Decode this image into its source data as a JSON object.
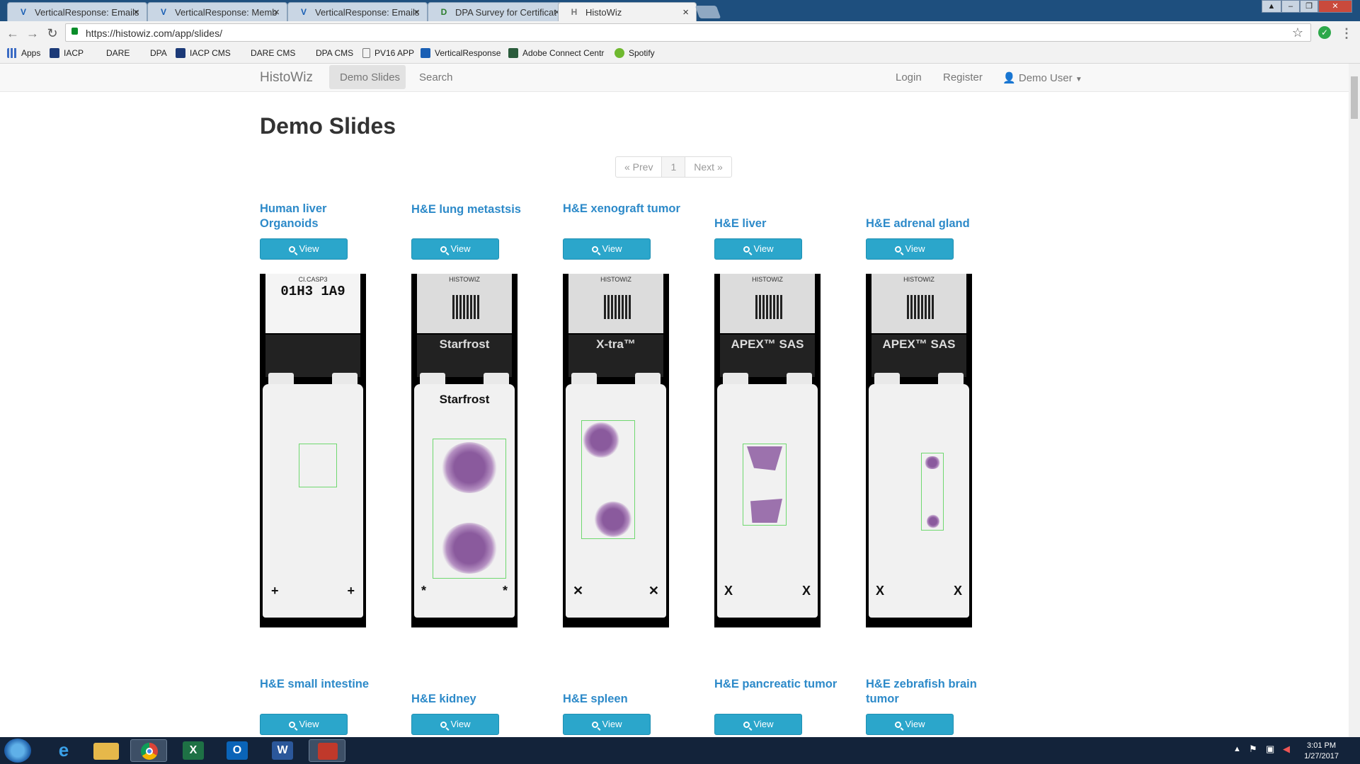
{
  "tabs": [
    {
      "label": "VerticalResponse: Emails",
      "icon": "V"
    },
    {
      "label": "VerticalResponse: Memb",
      "icon": "V"
    },
    {
      "label": "VerticalResponse: Emails",
      "icon": "V"
    },
    {
      "label": "DPA Survey for Certificat",
      "icon": "D"
    },
    {
      "label": "HistoWiz",
      "icon": "H"
    }
  ],
  "address": {
    "url": "https://histowiz.com/app/slides/"
  },
  "bookmarks": [
    "Apps",
    "IACP",
    "DARE",
    "DPA",
    "IACP CMS",
    "DARE CMS",
    "DPA CMS",
    "PV16 APP",
    "VerticalResponse",
    "Adobe Connect Centr",
    "Spotify"
  ],
  "navbar": {
    "brand": "HistoWiz",
    "demo": "Demo Slides",
    "search": "Search",
    "login": "Login",
    "register": "Register",
    "user": "Demo User"
  },
  "page": {
    "title": "Demo Slides",
    "pager": {
      "prev": "« Prev",
      "current": "1",
      "next": "Next »"
    },
    "view_label": "View"
  },
  "slides": [
    {
      "title": "Human liver Organoids",
      "label_top": "CI.CASP3",
      "label_big": "01H3  1A9",
      "mark": "+"
    },
    {
      "title": "H&E lung metastsis",
      "label_top": "HISTOWIZ",
      "label_big": "Starfrost",
      "mark": "*"
    },
    {
      "title": "H&E xenograft tumor",
      "label_top": "HISTOWIZ",
      "label_big": "X-tra™",
      "mark": "✕"
    },
    {
      "title": "H&E liver",
      "label_top": "HISTOWIZ",
      "label_big": "APEX™  SAS",
      "mark": "X"
    },
    {
      "title": "H&E adrenal gland",
      "label_top": "HISTOWIZ",
      "label_big": "APEX™  SAS",
      "mark": "X"
    }
  ],
  "slides_row2": [
    {
      "title": "H&E small intestine"
    },
    {
      "title": "H&E kidney"
    },
    {
      "title": "H&E spleen"
    },
    {
      "title": "H&E pancreatic tumor"
    },
    {
      "title": "H&E zebrafish brain tumor"
    }
  ],
  "clock": {
    "time": "3:01 PM",
    "date": "1/27/2017"
  }
}
